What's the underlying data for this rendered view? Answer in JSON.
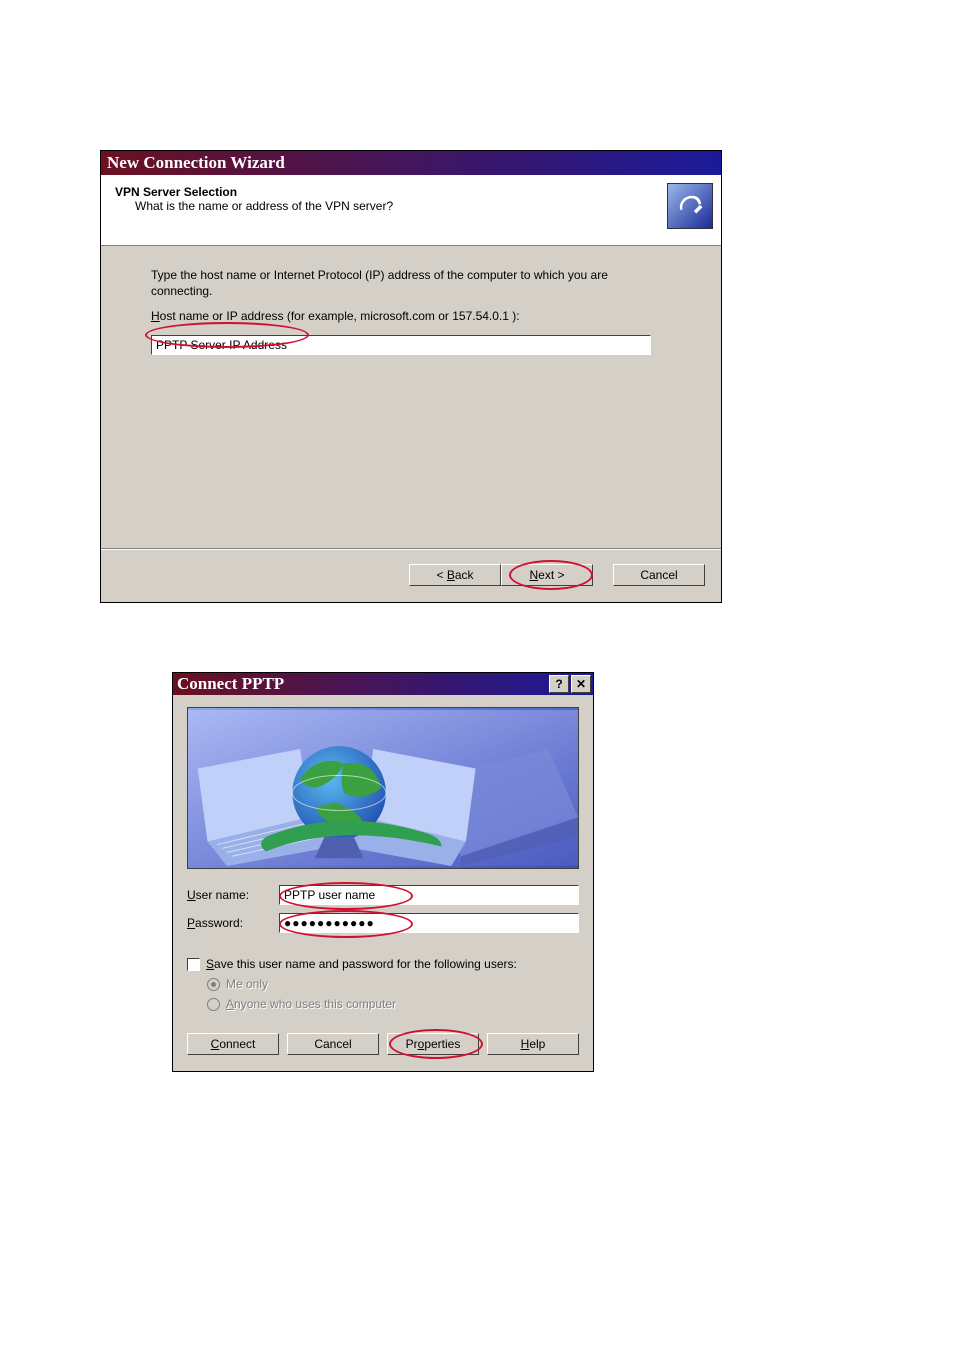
{
  "wizard": {
    "title": "New Connection Wizard",
    "header_title": "VPN Server Selection",
    "header_sub": "What is the name or address of the VPN server?",
    "body_text": "Type the host name or Internet Protocol (IP) address of the computer to which you are connecting.",
    "field_label_prefix": "H",
    "field_label_rest": "ost name or IP address (for example, microsoft.com or 157.54.0.1 ):",
    "field_value": "PPTP Server IP Address",
    "back_btn": "< Back",
    "next_btn": "Next >",
    "cancel_btn": "Cancel"
  },
  "connect": {
    "title": "Connect PPTP",
    "help_btn": "?",
    "close_btn": "✕",
    "user_label_u": "U",
    "user_label_rest": "ser name:",
    "user_value": "PPTP user name",
    "pass_label_u": "P",
    "pass_label_rest": "assword:",
    "pass_value": "●●●●●●●●●●●",
    "save_u": "S",
    "save_rest": "ave this user name and password for the following users:",
    "me_only": "Me only",
    "anyone_u": "A",
    "anyone_rest": "nyone who uses this computer",
    "connect_btn": "Connect",
    "cancel_btn": "Cancel",
    "properties_btn": "Properties",
    "help_btn2": "Help"
  }
}
